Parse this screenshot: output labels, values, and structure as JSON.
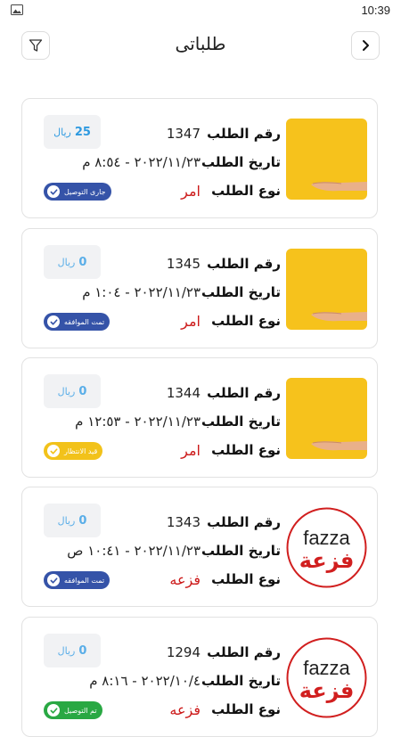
{
  "status_bar": {
    "time": "10:39"
  },
  "header": {
    "title": "طلباتى",
    "filter_icon": "filter-icon",
    "back_icon": "chevron-right-icon"
  },
  "labels": {
    "order_number": "رقم الطلب",
    "order_date": "تاريخ الطلب",
    "order_type": "نوع الطلب"
  },
  "orders": [
    {
      "number": "1347",
      "date": "٢٠٢٢/١١/٢٣ - ٨:٥٤ م",
      "type": "امر",
      "price": "25",
      "currency": "ريال",
      "status": "جارى التوصيل",
      "status_color": "#3553a8",
      "image": "hand-on-yellow"
    },
    {
      "number": "1345",
      "date": "٢٠٢٢/١١/٢٣ - ١:٠٤ م",
      "type": "امر",
      "price": "0",
      "currency": "ريال",
      "status": "تمت الموافقه",
      "status_color": "#3553a8",
      "image": "hand-on-yellow"
    },
    {
      "number": "1344",
      "date": "٢٠٢٢/١١/٢٣ - ١٢:٥٣ م",
      "type": "امر",
      "price": "0",
      "currency": "ريال",
      "status": "قيد الانتظار",
      "status_color": "#f2c21a",
      "image": "hand-on-yellow"
    },
    {
      "number": "1343",
      "date": "٢٠٢٢/١١/٢٣ - ١٠:٤١ ص",
      "type": "فزعه",
      "price": "0",
      "currency": "ريال",
      "status": "تمت الموافقه",
      "status_color": "#3553a8",
      "image": "fazza-logo"
    },
    {
      "number": "1294",
      "date": "٢٠٢٢/١٠/٤ - ٨:١٦ م",
      "type": "فزعه",
      "price": "0",
      "currency": "ريال",
      "status": "تم التوصيل",
      "status_color": "#29a843",
      "image": "fazza-logo"
    }
  ],
  "logo": {
    "latin": "fazza",
    "arabic": "فزعة"
  }
}
